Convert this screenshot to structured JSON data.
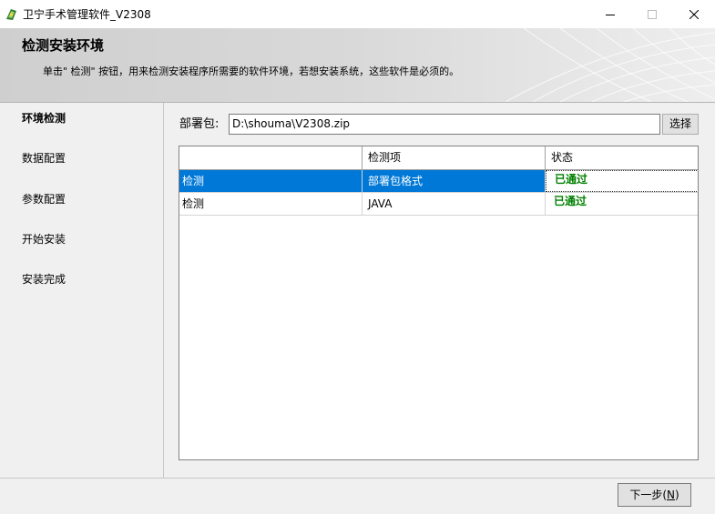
{
  "window": {
    "title": "卫宁手术管理软件_V2308"
  },
  "banner": {
    "title": "检测安装环境",
    "description": "单击\" 检测\" 按钮，用来检测安装程序所需要的软件环境，若想安装系统，这些软件是必须的。"
  },
  "sidebar": {
    "steps": [
      {
        "label": "环境检测",
        "active": true
      },
      {
        "label": "数据配置",
        "active": false
      },
      {
        "label": "参数配置",
        "active": false
      },
      {
        "label": "开始安装",
        "active": false
      },
      {
        "label": "安装完成",
        "active": false
      }
    ]
  },
  "package": {
    "label": "部署包:",
    "value": "D:\\shouma\\V2308.zip",
    "select_label": "选择"
  },
  "grid": {
    "columns": [
      "",
      "检测项",
      "状态"
    ],
    "rows": [
      {
        "action": "检测",
        "item": "部署包格式",
        "status": "已通过",
        "selected": true
      },
      {
        "action": "检测",
        "item": "JAVA",
        "status": "已通过",
        "selected": false
      }
    ]
  },
  "footer": {
    "next_label": "下一步(",
    "next_accel": "N",
    "next_close": ")"
  },
  "colors": {
    "selection": "#0078d7",
    "status_ok": "#008000"
  }
}
